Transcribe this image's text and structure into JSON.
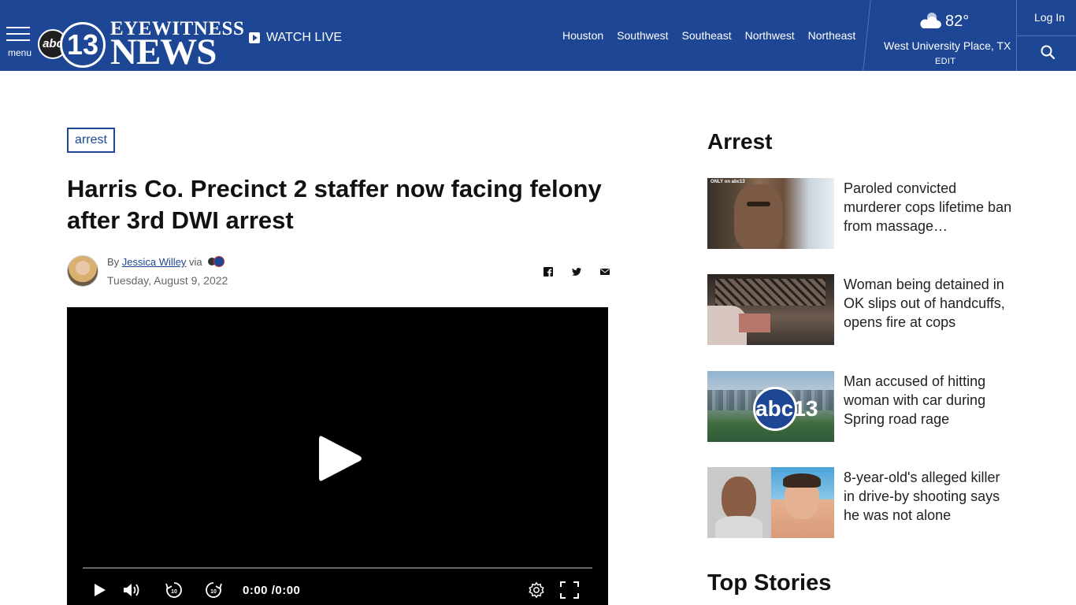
{
  "header": {
    "menu_label": "menu",
    "logo": {
      "abc": "abc",
      "number": "13",
      "eyewitness": "EYEWITNESS",
      "news": "NEWS"
    },
    "watch_live": "WATCH LIVE",
    "nav": [
      "Houston",
      "Southwest",
      "Southeast",
      "Northwest",
      "Northeast"
    ],
    "weather": {
      "icon": "partly-cloudy-icon",
      "temp": "82°",
      "location": "West University Place, TX",
      "edit": "EDIT"
    },
    "login": "Log In",
    "brand_color": "#1d4694"
  },
  "article": {
    "tag": "arrest",
    "headline": "Harris Co. Precinct 2 staffer now facing felony after 3rd DWI arrest",
    "byline_prefix": "By",
    "author": "Jessica Willey",
    "via": "via",
    "date": "Tuesday, August 9, 2022",
    "share_icons": [
      "facebook-icon",
      "twitter-icon",
      "email-icon"
    ]
  },
  "video": {
    "time": "0:00 /0:00",
    "controls": [
      "play-icon",
      "volume-icon",
      "rewind-10-icon",
      "forward-10-icon",
      "settings-icon",
      "fullscreen-icon"
    ],
    "progress": 0
  },
  "sidebar": {
    "title": "Arrest",
    "stories": [
      {
        "title": "Paroled convicted murderer cops lifetime ban from massage…",
        "thumb_label": "ONLY on abc13"
      },
      {
        "title": "Woman being detained in OK slips out of handcuffs, opens fire at cops"
      },
      {
        "title": "Man accused of hitting woman with car during Spring road rage",
        "thumb_label": "abc13"
      },
      {
        "title": "8-year-old's alleged killer in drive-by shooting says he was not alone"
      }
    ],
    "top_stories": "Top Stories"
  }
}
